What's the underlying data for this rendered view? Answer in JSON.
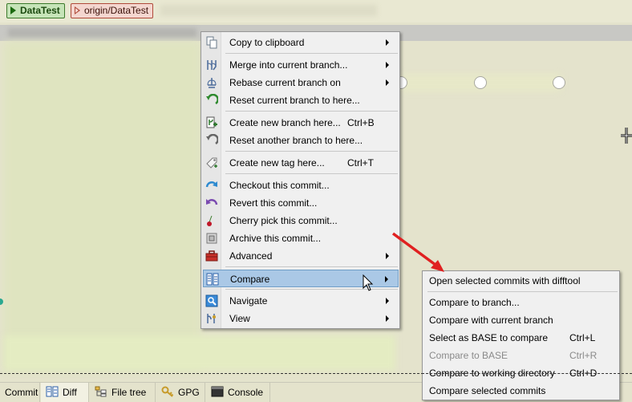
{
  "branches": {
    "local": "DataTest",
    "remote": "origin/DataTest"
  },
  "context_menu": {
    "items": [
      {
        "label": "Copy to clipboard",
        "icon": "copy-icon",
        "submenu": true
      },
      {
        "label": "Merge into current branch...",
        "icon": "merge-icon",
        "submenu": true
      },
      {
        "label": "Rebase current branch on",
        "icon": "rebase-icon",
        "submenu": true
      },
      {
        "label": "Reset current branch to here...",
        "icon": "reset-icon",
        "submenu": false
      },
      {
        "label": "Create new branch here...",
        "shortcut": "Ctrl+B",
        "icon": "branch-icon",
        "submenu": false
      },
      {
        "label": "Reset another branch to here...",
        "icon": "reset-other-icon",
        "submenu": false
      },
      {
        "label": "Create new tag here...",
        "shortcut": "Ctrl+T",
        "icon": "tag-icon",
        "submenu": false
      },
      {
        "label": "Checkout this commit...",
        "icon": "checkout-icon",
        "submenu": false
      },
      {
        "label": "Revert this commit...",
        "icon": "revert-icon",
        "submenu": false
      },
      {
        "label": "Cherry pick this commit...",
        "icon": "cherry-icon",
        "submenu": false
      },
      {
        "label": "Archive this commit...",
        "icon": "archive-icon",
        "submenu": false
      },
      {
        "label": "Advanced",
        "icon": "toolbox-icon",
        "submenu": true
      },
      {
        "label": "Compare",
        "icon": "compare-icon",
        "submenu": true,
        "highlighted": true
      },
      {
        "label": "Navigate",
        "icon": "navigate-icon",
        "submenu": true
      },
      {
        "label": "View",
        "icon": "view-icon",
        "submenu": true
      }
    ]
  },
  "compare_submenu": {
    "items": [
      {
        "label": "Open selected commits with difftool"
      },
      {
        "label": "Compare to branch..."
      },
      {
        "label": "Compare with current branch"
      },
      {
        "label": "Select as BASE to compare",
        "shortcut": "Ctrl+L"
      },
      {
        "label": "Compare to BASE",
        "shortcut": "Ctrl+R",
        "disabled": true
      },
      {
        "label": "Compare to working directory",
        "shortcut": "Ctrl+D"
      },
      {
        "label": "Compare selected commits"
      }
    ]
  },
  "bottom_tabs": [
    {
      "label": "Commit"
    },
    {
      "label": "Diff",
      "active": true
    },
    {
      "label": "File tree"
    },
    {
      "label": "GPG"
    },
    {
      "label": "Console"
    }
  ],
  "colors": {
    "highlight": "#aac8e6",
    "arrow": "#e02020"
  }
}
